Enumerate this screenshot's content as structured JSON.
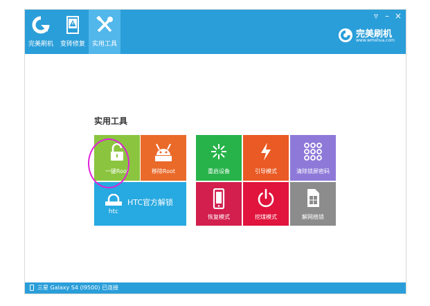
{
  "nav": {
    "tabs": [
      {
        "label": "完美刷机",
        "icon": "refresh-arrow-icon",
        "active": false
      },
      {
        "label": "变砖修复",
        "icon": "warning-screen-icon",
        "active": false
      },
      {
        "label": "实用工具",
        "icon": "tools-icon",
        "active": true
      }
    ]
  },
  "window_controls": {
    "menu": "▿",
    "minimize": "–",
    "close": "×"
  },
  "brand": {
    "name": "完美刷机",
    "url": "www.wmshua.com"
  },
  "section_title": "实用工具",
  "tiles": {
    "one_key_root": {
      "label": "一键Root",
      "color": "#8bc53f",
      "icon": "unlock-icon"
    },
    "remove_root": {
      "label": "移除Root",
      "color": "#ea6a2a",
      "icon": "robot-icon"
    },
    "htc_unlock": {
      "label": "HTC官方解锁",
      "color": "#27a9e1",
      "icon": "htc-lock-icon"
    },
    "reboot_device": {
      "label": "重启设备",
      "color": "#27b34a",
      "icon": "burst-icon"
    },
    "bootloader_mode": {
      "label": "引导模式",
      "color": "#ea5a24",
      "icon": "lightning-icon"
    },
    "clear_lock_pattern": {
      "label": "清除锁屏密码",
      "color": "#8e79d9",
      "icon": "pattern-grid-icon"
    },
    "recovery_mode": {
      "label": "恢复模式",
      "color": "#d21f4e",
      "icon": "phone-icon"
    },
    "fastboot_mode": {
      "label": "挖煤模式",
      "color": "#e0143c",
      "icon": "power-icon"
    },
    "network_unlock": {
      "label": "解网络锁",
      "color": "#8c8c8c",
      "icon": "sim-card-icon"
    }
  },
  "status": {
    "text": "三星 Galaxy S4 (I9500) 已连接",
    "icon": "phone-icon"
  }
}
